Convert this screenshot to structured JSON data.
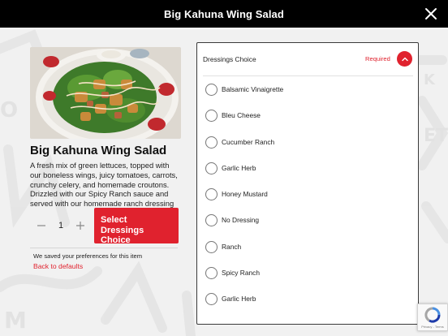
{
  "header": {
    "title": "Big Kahuna Wing Salad"
  },
  "item": {
    "name": "Big Kahuna Wing Salad",
    "description": "A fresh mix of green lettuces, topped with our boneless wings, juicy tomatoes, carrots, crunchy celery, and homemade croutons. Drizzled with our Spicy Ranch sauce and served with our homemade ranch dressing",
    "quantity": "1",
    "select_button_label": "Select Dressings Choice",
    "saved_note": "We saved your preferences for this item",
    "back_to_defaults": "Back to defaults"
  },
  "dressings": {
    "heading": "Dressings Choice",
    "required_label": "Required",
    "options": [
      "Balsamic Vinaigrette",
      "Bleu Cheese",
      "Cucumber Ranch",
      "Garlic Herb",
      "Honey Mustard",
      "No Dressing",
      "Ranch",
      "Spicy Ranch",
      "Garlic Herb"
    ]
  },
  "recaptcha": {
    "links": "Privacy - Terms"
  },
  "colors": {
    "accent": "#e0222e",
    "titlebar": "#000000",
    "background": "#f1f1f1"
  },
  "icons": {
    "close": "close-icon",
    "minus": "minus-icon",
    "plus": "plus-icon",
    "collapse": "chevron-up-icon",
    "recaptcha": "recaptcha-icon"
  }
}
